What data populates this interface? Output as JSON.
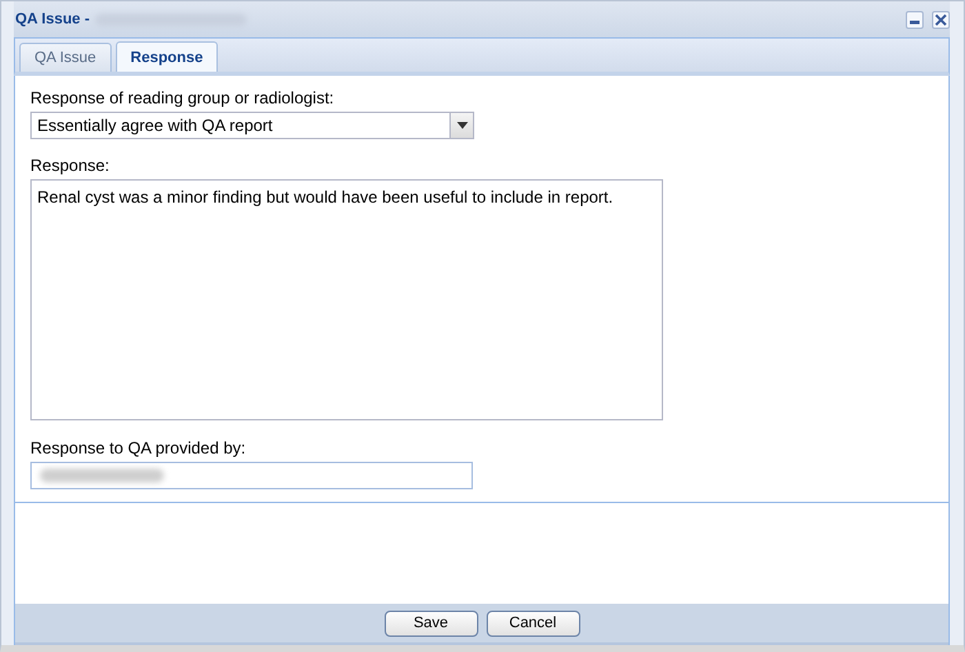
{
  "window": {
    "title": "QA Issue -"
  },
  "tabs": [
    {
      "label": "QA Issue",
      "selected": false
    },
    {
      "label": "Response",
      "selected": true
    }
  ],
  "form": {
    "response_label": "Response of reading group or radiologist:",
    "response_value": "Essentially agree with QA report",
    "text_label": "Response:",
    "text_value": "Renal cyst was a minor finding but would have been useful to include in report.",
    "provided_label": "Response to QA provided by:"
  },
  "buttons": [
    "Save",
    "Cancel"
  ]
}
